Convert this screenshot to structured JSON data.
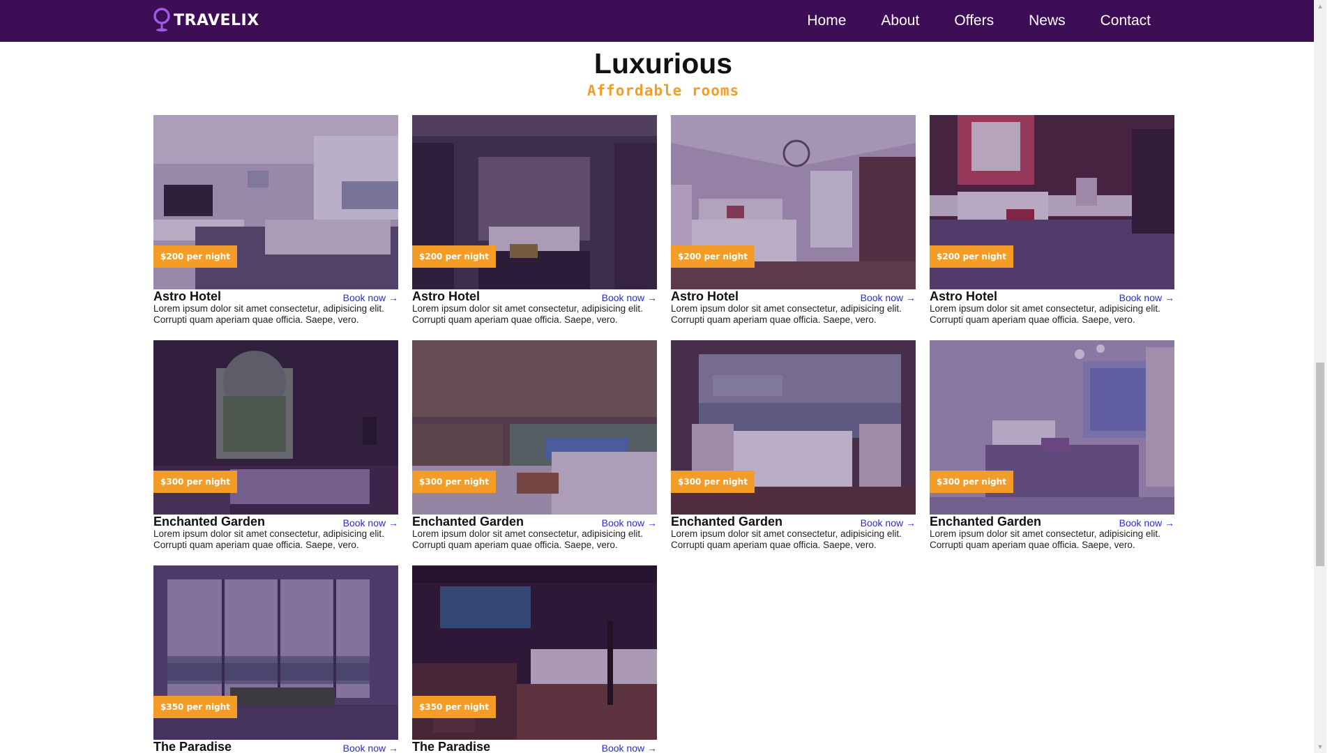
{
  "header": {
    "logo_text": "TRAVELIX",
    "nav": [
      "Home",
      "About",
      "Offers",
      "News",
      "Contact"
    ]
  },
  "section": {
    "title": "Luxurious",
    "subtitle": "Affordable rooms"
  },
  "cards": [
    {
      "name": "Astro Hotel",
      "price": "$200 per night",
      "link": "Book now →",
      "desc1": "Lorem ipsum dolor sit amet consectetur, adipisicing elit.",
      "desc2": "Corrupti quam aperiam quae officia. Saepe, vero.",
      "scene": "living-room"
    },
    {
      "name": "Astro Hotel",
      "price": "$200 per night",
      "link": "Book now →",
      "desc1": "Lorem ipsum dolor sit amet consectetur, adipisicing elit.",
      "desc2": "Corrupti quam aperiam quae officia. Saepe, vero.",
      "scene": "dark-bedroom"
    },
    {
      "name": "Astro Hotel",
      "price": "$200 per night",
      "link": "Book now →",
      "desc1": "Lorem ipsum dolor sit amet consectetur, adipisicing elit.",
      "desc2": "Corrupti quam aperiam quae officia. Saepe, vero.",
      "scene": "chandelier-bedroom"
    },
    {
      "name": "Astro Hotel",
      "price": "$200 per night",
      "link": "Book now →",
      "desc1": "Lorem ipsum dolor sit amet consectetur, adipisicing elit.",
      "desc2": "Corrupti quam aperiam quae officia. Saepe, vero.",
      "scene": "red-bedroom"
    },
    {
      "name": "Enchanted Garden",
      "price": "$300 per night",
      "link": "Book now →",
      "desc1": "Lorem ipsum dolor sit amet consectetur, adipisicing elit.",
      "desc2": "Corrupti quam aperiam quae officia. Saepe, vero.",
      "scene": "window-room"
    },
    {
      "name": "Enchanted Garden",
      "price": "$300 per night",
      "link": "Book now →",
      "desc1": "Lorem ipsum dolor sit amet consectetur, adipisicing elit.",
      "desc2": "Corrupti quam aperiam quae officia. Saepe, vero.",
      "scene": "pool-pergola"
    },
    {
      "name": "Enchanted Garden",
      "price": "$300 per night",
      "link": "Book now →",
      "desc1": "Lorem ipsum dolor sit amet consectetur, adipisicing elit.",
      "desc2": "Corrupti quam aperiam quae officia. Saepe, vero.",
      "scene": "dining-harbor"
    },
    {
      "name": "Enchanted Garden",
      "price": "$300 per night",
      "link": "Book now →",
      "desc1": "Lorem ipsum dolor sit amet consectetur, adipisicing elit.",
      "desc2": "Corrupti quam aperiam quae officia. Saepe, vero.",
      "scene": "light-bedroom"
    },
    {
      "name": "The Paradise",
      "price": "$350 per night",
      "link": "Book now →",
      "desc1": "",
      "desc2": "",
      "scene": "glass-lounge"
    },
    {
      "name": "The Paradise",
      "price": "$350 per night",
      "link": "Book now →",
      "desc1": "",
      "desc2": "",
      "scene": "night-pool"
    }
  ],
  "colors": {
    "header_bg": "#3d0e55",
    "accent": "#f39c28",
    "link": "#2a2bd6",
    "overlay": "#3d0e55"
  }
}
